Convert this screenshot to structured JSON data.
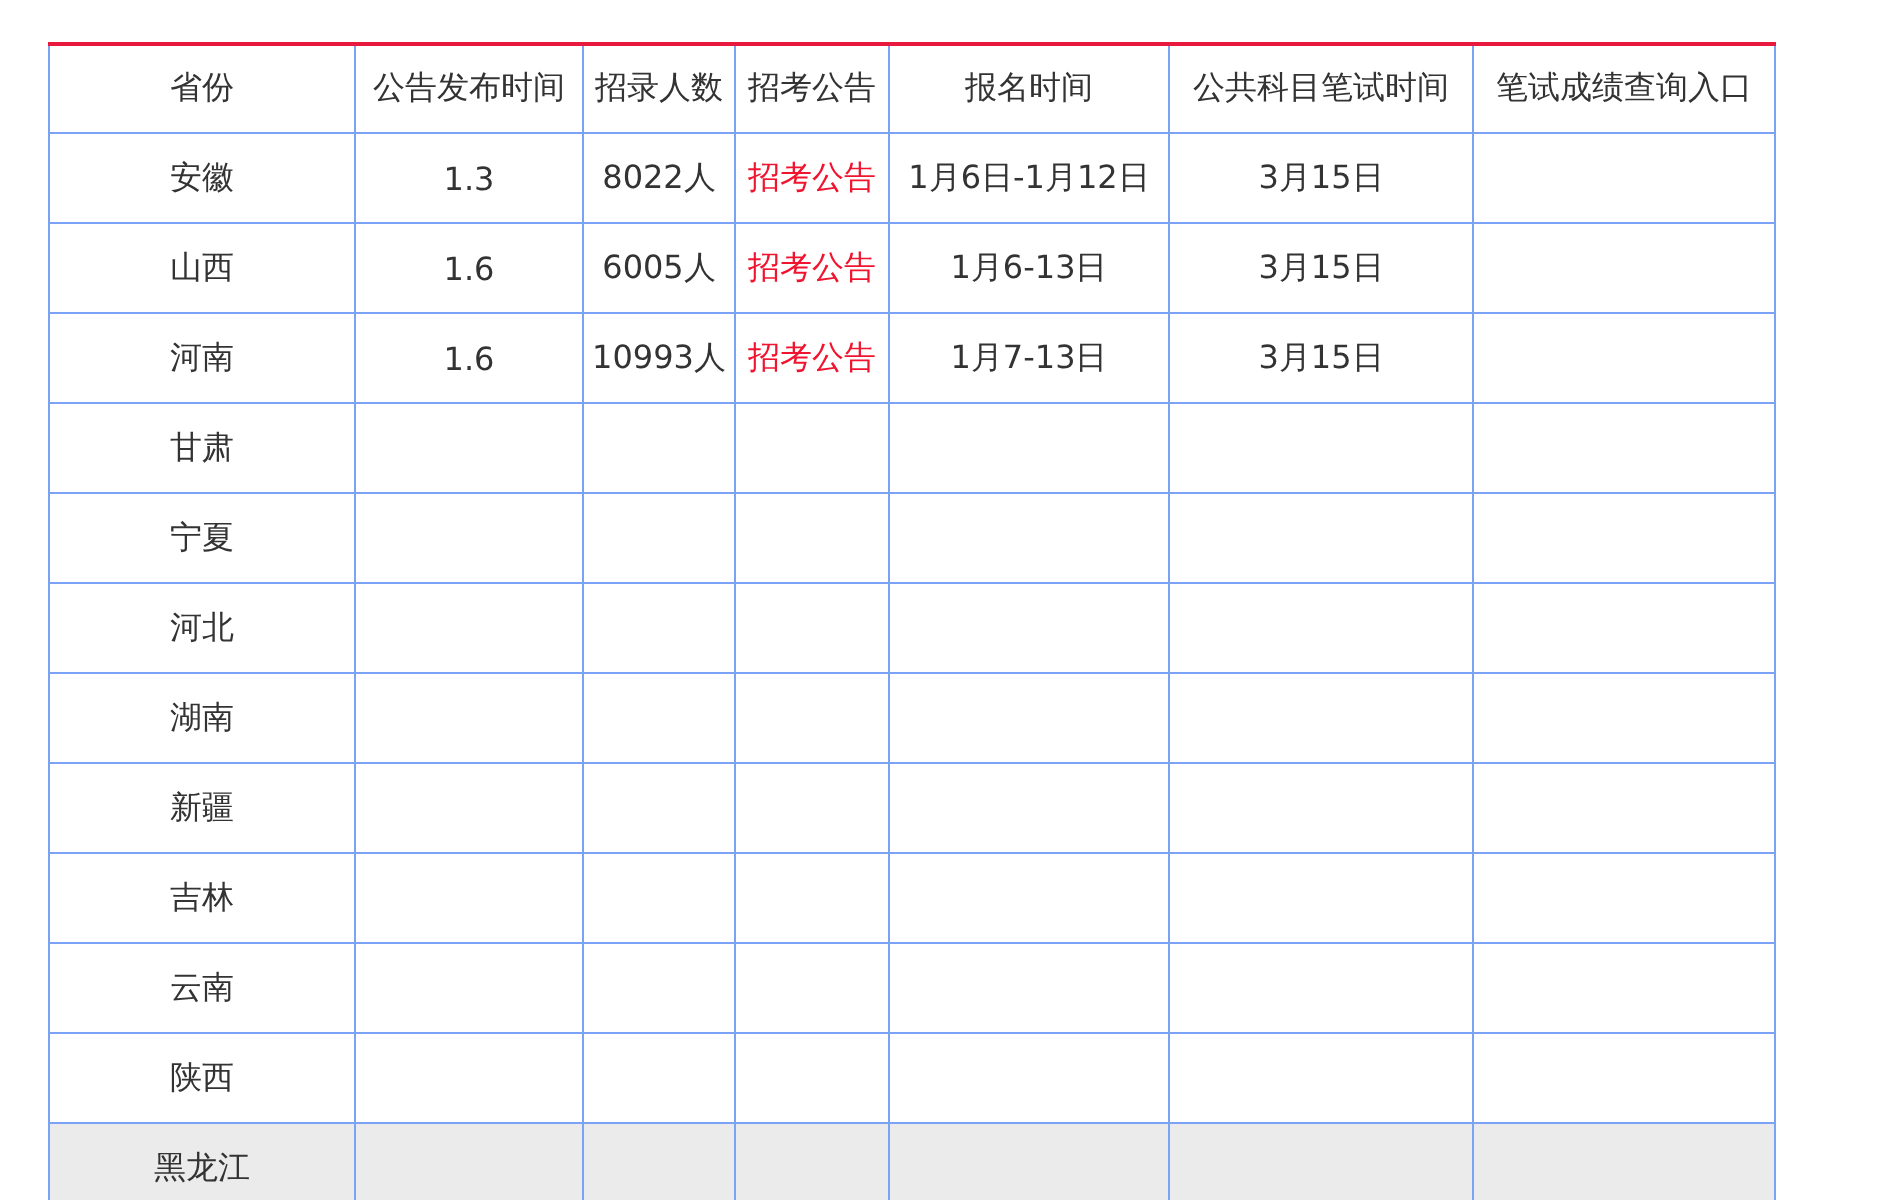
{
  "table": {
    "columns": [
      "省份",
      "公告发布时间",
      "招录人数",
      "招考公告",
      "报名时间",
      "公共科目笔试时间",
      "笔试成绩查询入口"
    ],
    "rows": [
      {
        "province": "安徽",
        "announce_date": "1.3",
        "recruits": "8022人",
        "notice": "招考公告",
        "signup": "1月6日-1月12日",
        "exam_date": "3月15日",
        "highlighted": false
      },
      {
        "province": "山西",
        "announce_date": "1.6",
        "recruits": "6005人",
        "notice": "招考公告",
        "signup": "1月6-13日",
        "exam_date": "3月15日",
        "highlighted": false
      },
      {
        "province": "河南",
        "announce_date": "1.6",
        "recruits": "10993人",
        "notice": "招考公告",
        "signup": "1月7-13日",
        "exam_date": "3月15日",
        "highlighted": false
      },
      {
        "province": "甘肃",
        "highlighted": false
      },
      {
        "province": "宁夏",
        "highlighted": false
      },
      {
        "province": "河北",
        "highlighted": false
      },
      {
        "province": "湖南",
        "highlighted": false
      },
      {
        "province": "新疆",
        "highlighted": false
      },
      {
        "province": "吉林",
        "highlighted": false
      },
      {
        "province": "云南",
        "highlighted": false
      },
      {
        "province": "陕西",
        "highlighted": false
      },
      {
        "province": "黑龙江",
        "highlighted": true
      }
    ]
  }
}
